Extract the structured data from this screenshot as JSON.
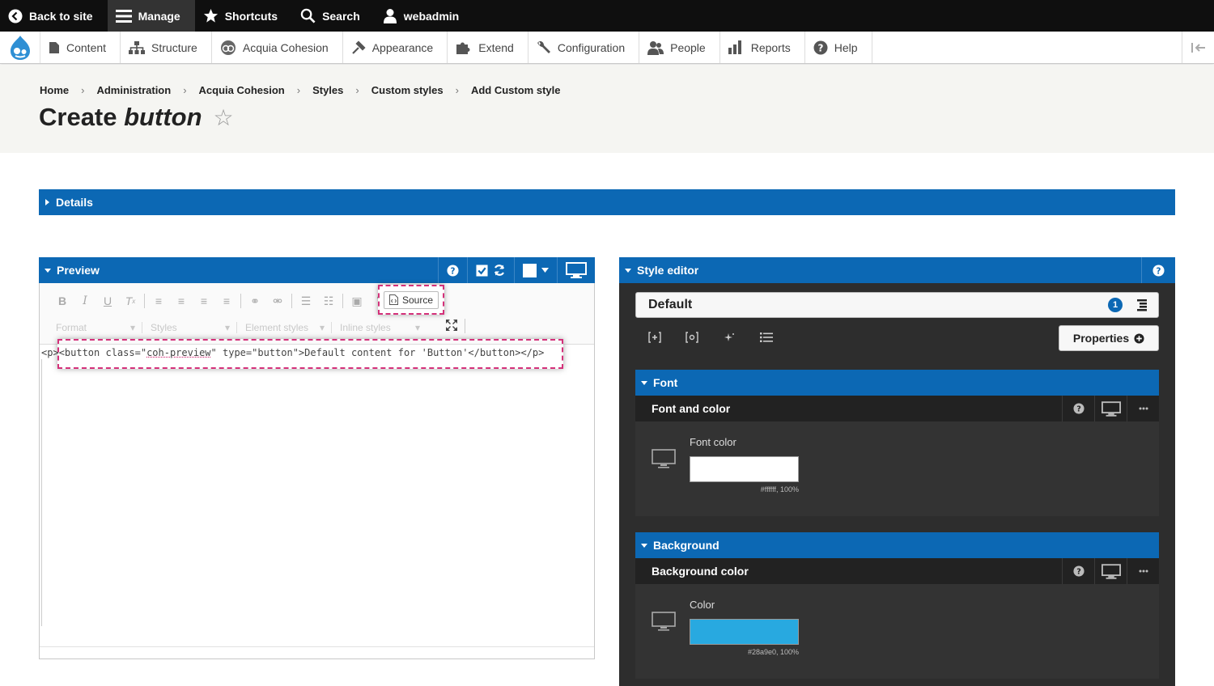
{
  "topbar": {
    "back_label": "Back to site",
    "manage_label": "Manage",
    "shortcuts_label": "Shortcuts",
    "search_label": "Search",
    "user_label": "webadmin"
  },
  "tray": {
    "items": [
      {
        "label": "Content",
        "icon": "document-icon"
      },
      {
        "label": "Structure",
        "icon": "structure-icon"
      },
      {
        "label": "Acquia Cohesion",
        "icon": "cohesion-icon"
      },
      {
        "label": "Appearance",
        "icon": "brush-icon"
      },
      {
        "label": "Extend",
        "icon": "puzzle-icon"
      },
      {
        "label": "Configuration",
        "icon": "wrench-icon"
      },
      {
        "label": "People",
        "icon": "people-icon"
      },
      {
        "label": "Reports",
        "icon": "bar-chart-icon"
      },
      {
        "label": "Help",
        "icon": "help-icon"
      }
    ]
  },
  "breadcrumb": [
    "Home",
    "Administration",
    "Acquia Cohesion",
    "Styles",
    "Custom styles",
    "Add Custom style"
  ],
  "page": {
    "title_prefix": "Create",
    "title_em": "button",
    "star": "☆"
  },
  "details": {
    "label": "Details"
  },
  "preview": {
    "label": "Preview",
    "source_label": "Source",
    "format_label": "Format",
    "styles_label": "Styles",
    "element_styles_label": "Element styles",
    "inline_styles_label": "Inline styles",
    "code_p_open": "<p>",
    "code_button_open": "<button class=\"",
    "code_class": "coh-preview",
    "code_rest": "\" type=\"button\">Default content for 'Button'</button>",
    "code_p_close": "</p>"
  },
  "style_editor": {
    "label": "Style editor",
    "selector": "Default",
    "selector_badge": "1",
    "properties_label": "Properties",
    "sections": [
      {
        "label": "Font",
        "sub_label": "Font and color",
        "field_label": "Font color",
        "swatch_color": "#ffffff",
        "swatch_value": "#ffffff, 100%"
      },
      {
        "label": "Background",
        "sub_label": "Background color",
        "field_label": "Color",
        "swatch_color": "#28a9e0",
        "swatch_value": "#28a9e0, 100%"
      }
    ]
  },
  "colors": {
    "accent_blue": "#0c68b4",
    "highlight": "#d4317a"
  }
}
